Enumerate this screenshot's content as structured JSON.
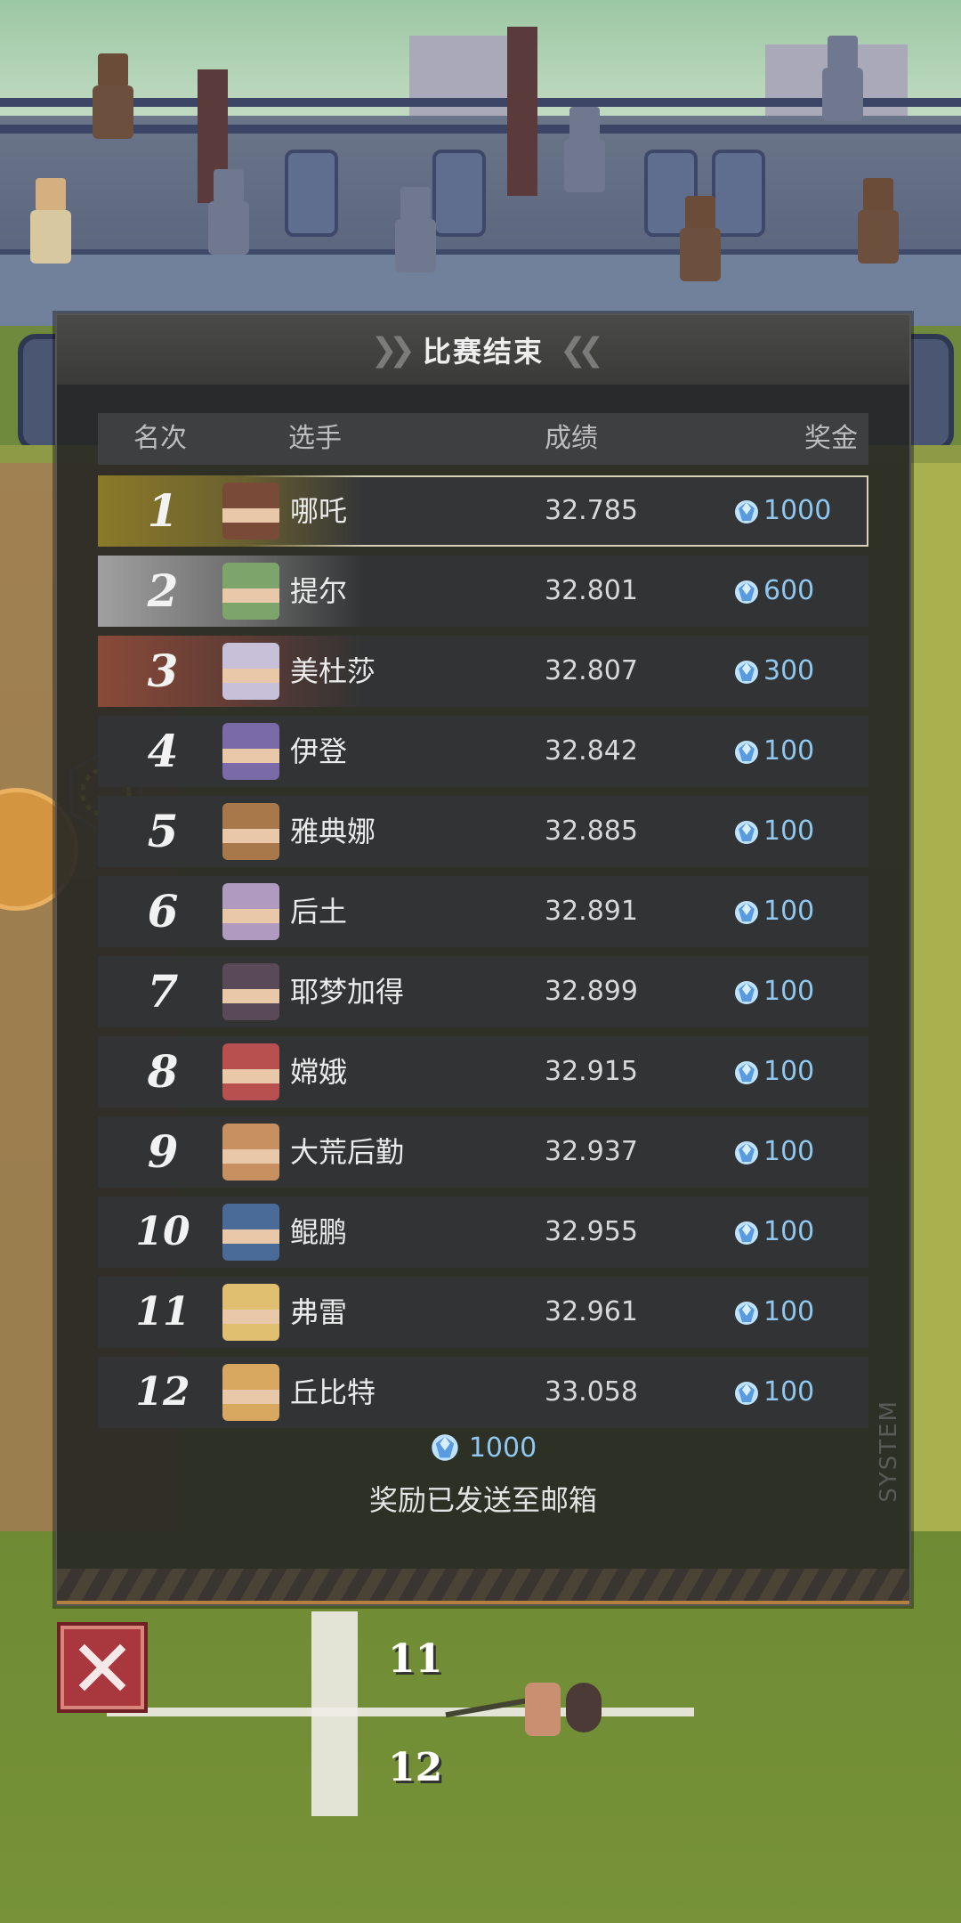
{
  "panel": {
    "title": "比赛结束",
    "headers": {
      "rank": "名次",
      "player": "选手",
      "score": "成绩",
      "prize": "奖金"
    },
    "rows": [
      {
        "rank": "1",
        "name": "哪吒",
        "score": "32.785",
        "prize": "1000",
        "avatar_color": "#7a4a38"
      },
      {
        "rank": "2",
        "name": "提尔",
        "score": "32.801",
        "prize": "600",
        "avatar_color": "#7da46a"
      },
      {
        "rank": "3",
        "name": "美杜莎",
        "score": "32.807",
        "prize": "300",
        "avatar_color": "#c8c0d8"
      },
      {
        "rank": "4",
        "name": "伊登",
        "score": "32.842",
        "prize": "100",
        "avatar_color": "#7a6aa8"
      },
      {
        "rank": "5",
        "name": "雅典娜",
        "score": "32.885",
        "prize": "100",
        "avatar_color": "#a8784a"
      },
      {
        "rank": "6",
        "name": "后土",
        "score": "32.891",
        "prize": "100",
        "avatar_color": "#b09ac0"
      },
      {
        "rank": "7",
        "name": "耶梦加得",
        "score": "32.899",
        "prize": "100",
        "avatar_color": "#5a4a58"
      },
      {
        "rank": "8",
        "name": "嫦娥",
        "score": "32.915",
        "prize": "100",
        "avatar_color": "#b85050"
      },
      {
        "rank": "9",
        "name": "大荒后勤",
        "score": "32.937",
        "prize": "100",
        "avatar_color": "#c89060"
      },
      {
        "rank": "10",
        "name": "鲲鹏",
        "score": "32.955",
        "prize": "100",
        "avatar_color": "#4a6a98"
      },
      {
        "rank": "11",
        "name": "弗雷",
        "score": "32.961",
        "prize": "100",
        "avatar_color": "#e0c070"
      },
      {
        "rank": "12",
        "name": "丘比特",
        "score": "33.058",
        "prize": "100",
        "avatar_color": "#d8a860"
      }
    ],
    "total_prize": "1000",
    "mail_message": "奖励已发送至邮箱",
    "side_tag": "SYSTEM"
  },
  "scene": {
    "lane_numbers": [
      "11",
      "12"
    ]
  },
  "colors": {
    "gem": "#8fc7f0",
    "gold": "#8a7a28",
    "silver": "#a0a0a0",
    "bronze": "#8a4a38",
    "close_button": "#a8383e"
  },
  "icons": {
    "close": "close-icon",
    "gem": "gem-icon",
    "chevron": "double-chevron-icon"
  }
}
